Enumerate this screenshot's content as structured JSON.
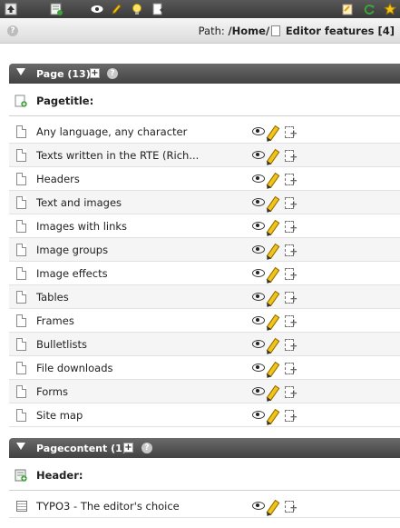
{
  "toolbar": {
    "icons": [
      "up-arrow-icon",
      "new-record-icon",
      "view-icon",
      "edit-pencil-icon",
      "lightbulb-icon",
      "paste-icon",
      "clipboard-icon",
      "refresh-icon",
      "bookmark-star-icon"
    ],
    "help_glyph": "?"
  },
  "path": {
    "label": "Path:",
    "value": "/Home/",
    "page_title": "Editor features [4]"
  },
  "sections": [
    {
      "title": "Page (13)",
      "plus": "+",
      "help": "?",
      "column_label": "Pagetitle:",
      "rows": [
        "Any language, any character",
        "Texts written in the RTE (Rich...",
        "Headers",
        "Text and images",
        "Images with links",
        "Image groups",
        "Image effects",
        "Tables",
        "Frames",
        "Bulletlists",
        "File downloads",
        "Forms",
        "Site map"
      ]
    },
    {
      "title": "Pagecontent (1)",
      "plus": "+",
      "help": "?",
      "column_label": "Header:",
      "rows": [
        "TYPO3 - The editor's choice"
      ]
    }
  ],
  "colors": {
    "toolbar_bg": "#484848",
    "section_header_bg": "#555555",
    "row_alt_bg": "#f5f5f5",
    "pencil_yellow": "#f2c31a"
  }
}
